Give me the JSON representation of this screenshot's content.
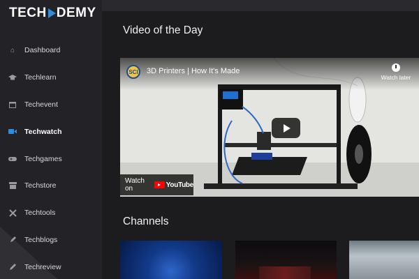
{
  "brand": {
    "name_left": "TECH",
    "name_right": "DEMY",
    "accent_color": "#2f8dde"
  },
  "sidebar": {
    "items": [
      {
        "label": "Dashboard",
        "icon": "home-icon",
        "glyph": "⌂"
      },
      {
        "label": "Techlearn",
        "icon": "graduation-cap-icon",
        "glyph": "🎓"
      },
      {
        "label": "Techevent",
        "icon": "calendar-icon",
        "glyph": "▦"
      },
      {
        "label": "Techwatch",
        "icon": "video-camera-icon",
        "glyph": "■"
      },
      {
        "label": "Techgames",
        "icon": "gamepad-icon",
        "glyph": "◉"
      },
      {
        "label": "Techstore",
        "icon": "store-icon",
        "glyph": "▭"
      },
      {
        "label": "Techtools",
        "icon": "tools-icon",
        "glyph": "✕"
      },
      {
        "label": "Techblogs",
        "icon": "blog-icon",
        "glyph": "✎"
      },
      {
        "label": "Techreview",
        "icon": "pencil-icon",
        "glyph": "✎"
      }
    ],
    "active_index": 3
  },
  "main": {
    "video_section_title": "Video of the Day",
    "channels_section_title": "Channels"
  },
  "video": {
    "channel_logo_text": "SCI",
    "title": "3D Printers | How It's Made",
    "watch_later_label": "Watch later",
    "watch_on_label": "Watch on",
    "youtube_label": "YouTube"
  }
}
